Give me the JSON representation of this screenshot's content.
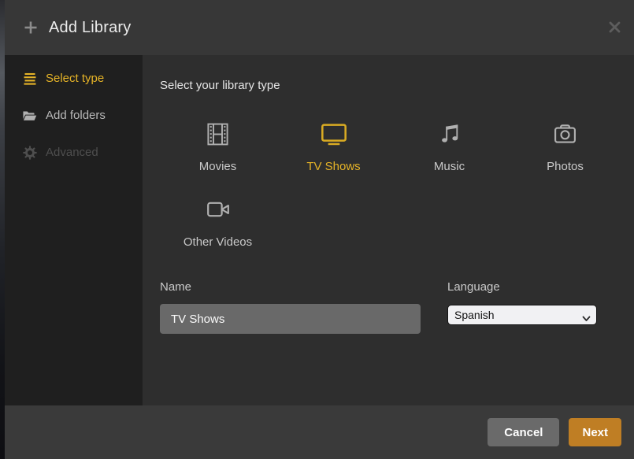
{
  "modal": {
    "title": "Add Library",
    "title_icon": "plus-icon",
    "close_icon": "close-x-icon"
  },
  "sidebar": {
    "items": [
      {
        "label": "Select type",
        "icon": "list-lines-icon",
        "state": "active"
      },
      {
        "label": "Add folders",
        "icon": "folder-open-icon",
        "state": "normal"
      },
      {
        "label": "Advanced",
        "icon": "gear-icon",
        "state": "disabled"
      }
    ]
  },
  "main": {
    "heading": "Select your library type",
    "types": [
      {
        "label": "Movies",
        "icon": "film-strip-icon",
        "selected": false
      },
      {
        "label": "TV Shows",
        "icon": "tv-icon",
        "selected": true
      },
      {
        "label": "Music",
        "icon": "music-notes-icon",
        "selected": false
      },
      {
        "label": "Photos",
        "icon": "camera-icon",
        "selected": false
      },
      {
        "label": "Other Videos",
        "icon": "video-camera-icon",
        "selected": false
      }
    ],
    "name_field": {
      "label": "Name",
      "value": "TV Shows"
    },
    "language_field": {
      "label": "Language",
      "value": "Spanish"
    }
  },
  "footer": {
    "cancel_label": "Cancel",
    "next_label": "Next"
  },
  "colors": {
    "accent_gold": "#e5b327",
    "next_orange": "#bf7e24",
    "cancel_gray": "#6a6a6a",
    "icon_gray": "#b0b0b0",
    "header_bg": "#373737",
    "sidebar_bg": "#1f1f1f",
    "content_bg": "#2e2e2e",
    "footer_bg": "#3a3a3a",
    "input_bg": "#696969"
  }
}
